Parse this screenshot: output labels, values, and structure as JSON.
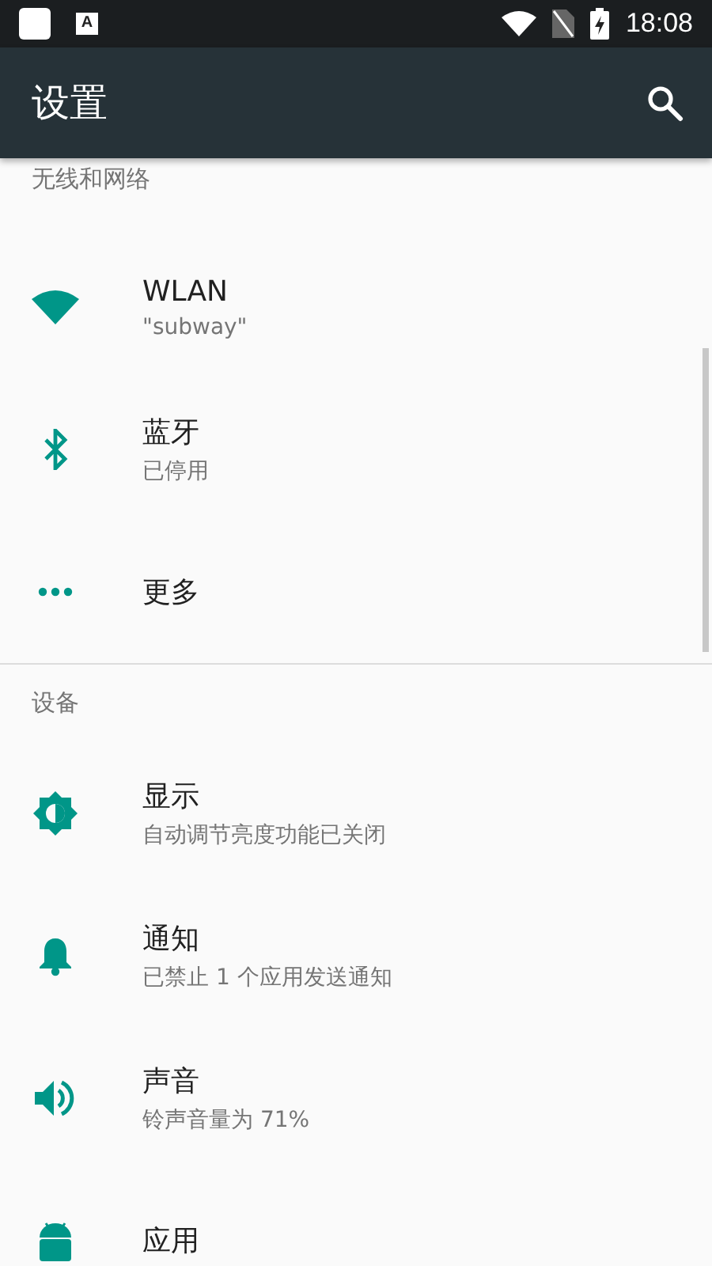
{
  "status_bar": {
    "notification_label": "A",
    "time": "18:08"
  },
  "toolbar": {
    "title": "设置"
  },
  "sections": [
    {
      "header": "无线和网络",
      "items": [
        {
          "title": "WLAN",
          "subtitle": "\"subway\""
        },
        {
          "title": "蓝牙",
          "subtitle": "已停用"
        },
        {
          "title": "更多"
        }
      ]
    },
    {
      "header": "设备",
      "items": [
        {
          "title": "显示",
          "subtitle": "自动调节亮度功能已关闭"
        },
        {
          "title": "通知",
          "subtitle": "已禁止 1 个应用发送通知"
        },
        {
          "title": "声音",
          "subtitle": "铃声音量为 71%"
        },
        {
          "title": "应用"
        }
      ]
    }
  ]
}
